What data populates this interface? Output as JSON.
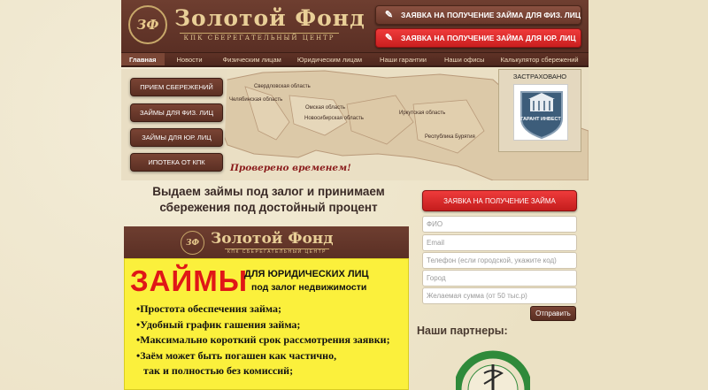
{
  "header": {
    "logo_monogram": "ЗФ",
    "title": "Золотой Фонд",
    "subtitle": "КПК СБЕРЕГАТЕЛЬНЫЙ ЦЕНТР",
    "btn_individual": "ЗАЯВКА НА ПОЛУЧЕНИЕ ЗАЙМА ДЛЯ ФИЗ. ЛИЦ",
    "btn_legal": "ЗАЯВКА НА ПОЛУЧЕНИЕ ЗАЙМА ДЛЯ ЮР. ЛИЦ"
  },
  "nav": {
    "items": [
      "Главная",
      "Новости",
      "Физическим лицам",
      "Юридическим лицам",
      "Наши гарантии",
      "Наши офисы",
      "Калькулятор сбережений"
    ],
    "active_index": 0
  },
  "map": {
    "regions": [
      "Свердловская область",
      "Челябинская область",
      "Омская область",
      "Новосибирская область",
      "Иркутская область",
      "Республика Бурятия"
    ],
    "side_buttons": [
      "ПРИЕМ СБЕРЕЖЕНИЙ",
      "ЗАЙМЫ ДЛЯ ФИЗ. ЛИЦ",
      "ЗАЙМЫ ДЛЯ ЮР. ЛИЦ",
      "ИПОТЕКА ОТ КПК"
    ],
    "slogan": "Проверено временем!",
    "insured_label": "ЗАСТРАХОВАНО",
    "insurer_name": "ГАРАНТ ИНВЕСТ"
  },
  "headline": {
    "line1": "Выдаем займы под залог и принимаем",
    "line2": "сбережения под достойный процент"
  },
  "banner": {
    "monogram": "ЗФ",
    "title": "Золотой Фонд",
    "subtitle": "КПК СБЕРЕГАТЕЛЬНЫЙ ЦЕНТР",
    "loans": "ЗАЙМЫ",
    "for_whom": "ДЛЯ ЮРИДИЧЕСКИХ ЛИЦ",
    "secured": "под залог недвижимости",
    "bullets": [
      "•Простота обеспечения займа;",
      "•Удобный график гашения займа;",
      "•Максимально короткий срок рассмотрения заявки;",
      "•Заём может быть погашен как частично,",
      "так и полностью без комиссий;"
    ]
  },
  "form": {
    "title": "ЗАЯВКА НА ПОЛУЧЕНИЕ ЗАЙМА",
    "placeholders": [
      "ФИО",
      "Email",
      "Телефон (если городской, укажите код)",
      "Город",
      "Желаемая сумма (от 50 тыс.р)"
    ],
    "submit": "Отправить"
  },
  "partners": {
    "title": "Наши партнеры:"
  },
  "colors": {
    "brown": "#5a2f24",
    "red": "#d62222",
    "gold": "#e9cf97",
    "yellow": "#fbf03c",
    "background": "#efe7cf"
  }
}
